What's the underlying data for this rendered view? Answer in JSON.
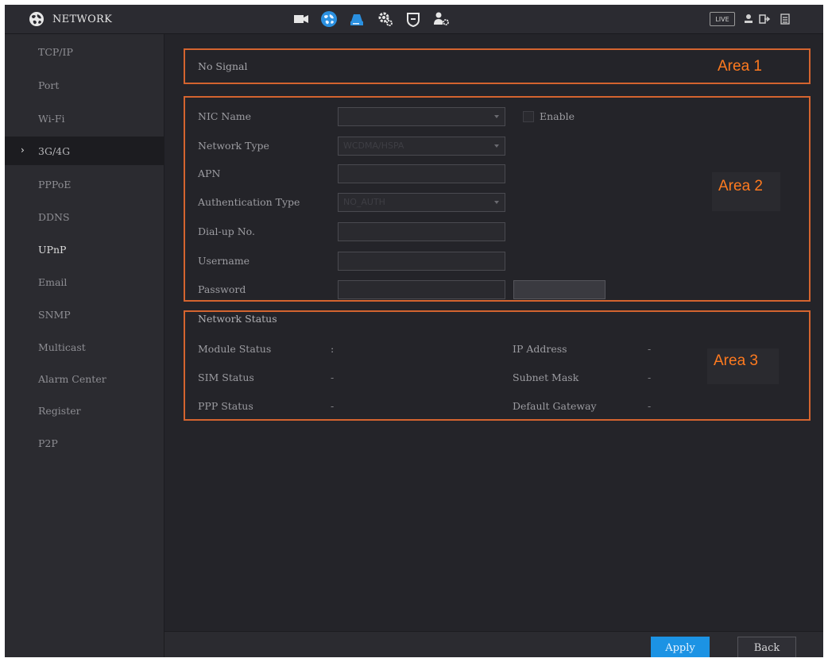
{
  "header": {
    "title": "NETWORK",
    "live_label": "LIVE",
    "nav_icons": [
      "camera-icon",
      "network-icon",
      "storage-icon",
      "settings-icon",
      "security-icon",
      "account-icon"
    ],
    "right_icons": [
      "user-icon",
      "logout-icon",
      "menu-icon"
    ]
  },
  "sidebar": {
    "items": [
      {
        "label": "TCP/IP"
      },
      {
        "label": "Port"
      },
      {
        "label": "Wi-Fi"
      },
      {
        "label": "3G/4G",
        "arrow": "›"
      },
      {
        "label": "PPPoE"
      },
      {
        "label": "DDNS"
      },
      {
        "label": "UPnP"
      },
      {
        "label": "Email"
      },
      {
        "label": "SNMP"
      },
      {
        "label": "Multicast"
      },
      {
        "label": "Alarm Center"
      },
      {
        "label": "Register"
      },
      {
        "label": "P2P"
      }
    ]
  },
  "area1": {
    "signal_text": "No Signal",
    "label": "Area 1"
  },
  "area2": {
    "label": "Area 2",
    "nic_name_label": "NIC Name",
    "enable_label": "Enable",
    "network_type_label": "Network Type",
    "network_type_value": "WCDMA/HSPA",
    "apn_label": "APN",
    "auth_type_label": "Authentication Type",
    "auth_type_value": "NO_AUTH",
    "dialup_label": "Dial-up No.",
    "username_label": "Username",
    "password_label": "Password"
  },
  "area3": {
    "label": "Area 3",
    "section_title": "Network Status",
    "module_status_label": "Module Status",
    "module_status_value": ":",
    "sim_status_label": "SIM Status",
    "sim_status_value": "-",
    "ppp_status_label": "PPP Status",
    "ppp_status_value": "-",
    "ip_address_label": "IP Address",
    "ip_address_value": "-",
    "subnet_mask_label": "Subnet Mask",
    "subnet_mask_value": "-",
    "default_gateway_label": "Default Gateway",
    "default_gateway_value": "-"
  },
  "footer": {
    "apply_label": "Apply",
    "back_label": "Back"
  },
  "colors": {
    "background": "#242429",
    "accent_blue": "#1c93e4",
    "annotation_orange": "#d4642f",
    "annotation_text": "#ff7a1f"
  }
}
